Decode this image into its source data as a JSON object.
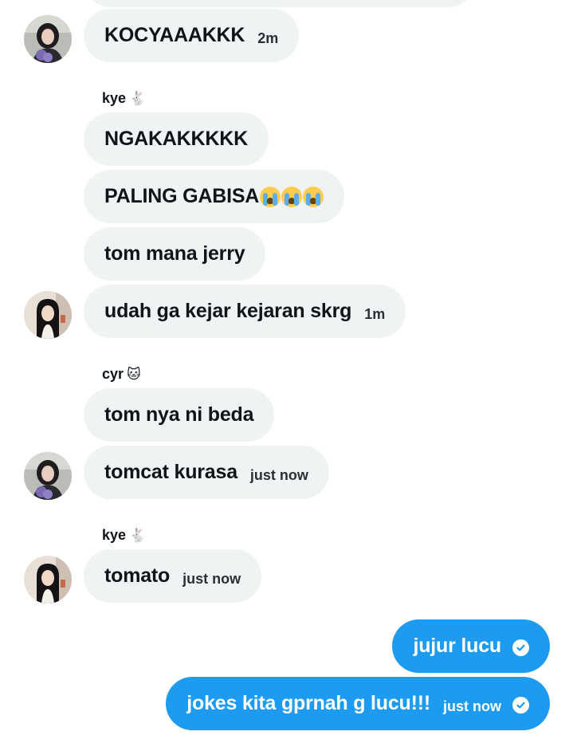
{
  "colors": {
    "received_bubble": "#eff3f4",
    "sent_bubble": "#1d9bf0",
    "text": "#0f1419"
  },
  "messages": [
    {
      "text": "KOCYAAAKKK",
      "time": "2m"
    },
    {
      "sender_name": "kye",
      "sender_emoji": "🐇"
    },
    {
      "text": "NGAKAKKKKK"
    },
    {
      "text": "PALING GABISA",
      "emoji_name": "loudly-crying-face",
      "emoji_count": 3
    },
    {
      "text": "tom mana jerry"
    },
    {
      "text": "udah ga kejar kejaran skrg",
      "time": "1m"
    },
    {
      "sender_name": "cyr",
      "sender_emoji": "🐱"
    },
    {
      "text": "tom nya ni beda"
    },
    {
      "text": "tomcat kurasa",
      "time": "just now"
    },
    {
      "sender_name": "kye",
      "sender_emoji": "🐇"
    },
    {
      "text": "tomato",
      "time": "just now"
    },
    {
      "text": "jujur lucu",
      "status_icon": "check-circle-icon"
    },
    {
      "text": "jokes kita gprnah g lucu!!!",
      "time": "just now",
      "status_icon": "check-circle-icon"
    }
  ]
}
